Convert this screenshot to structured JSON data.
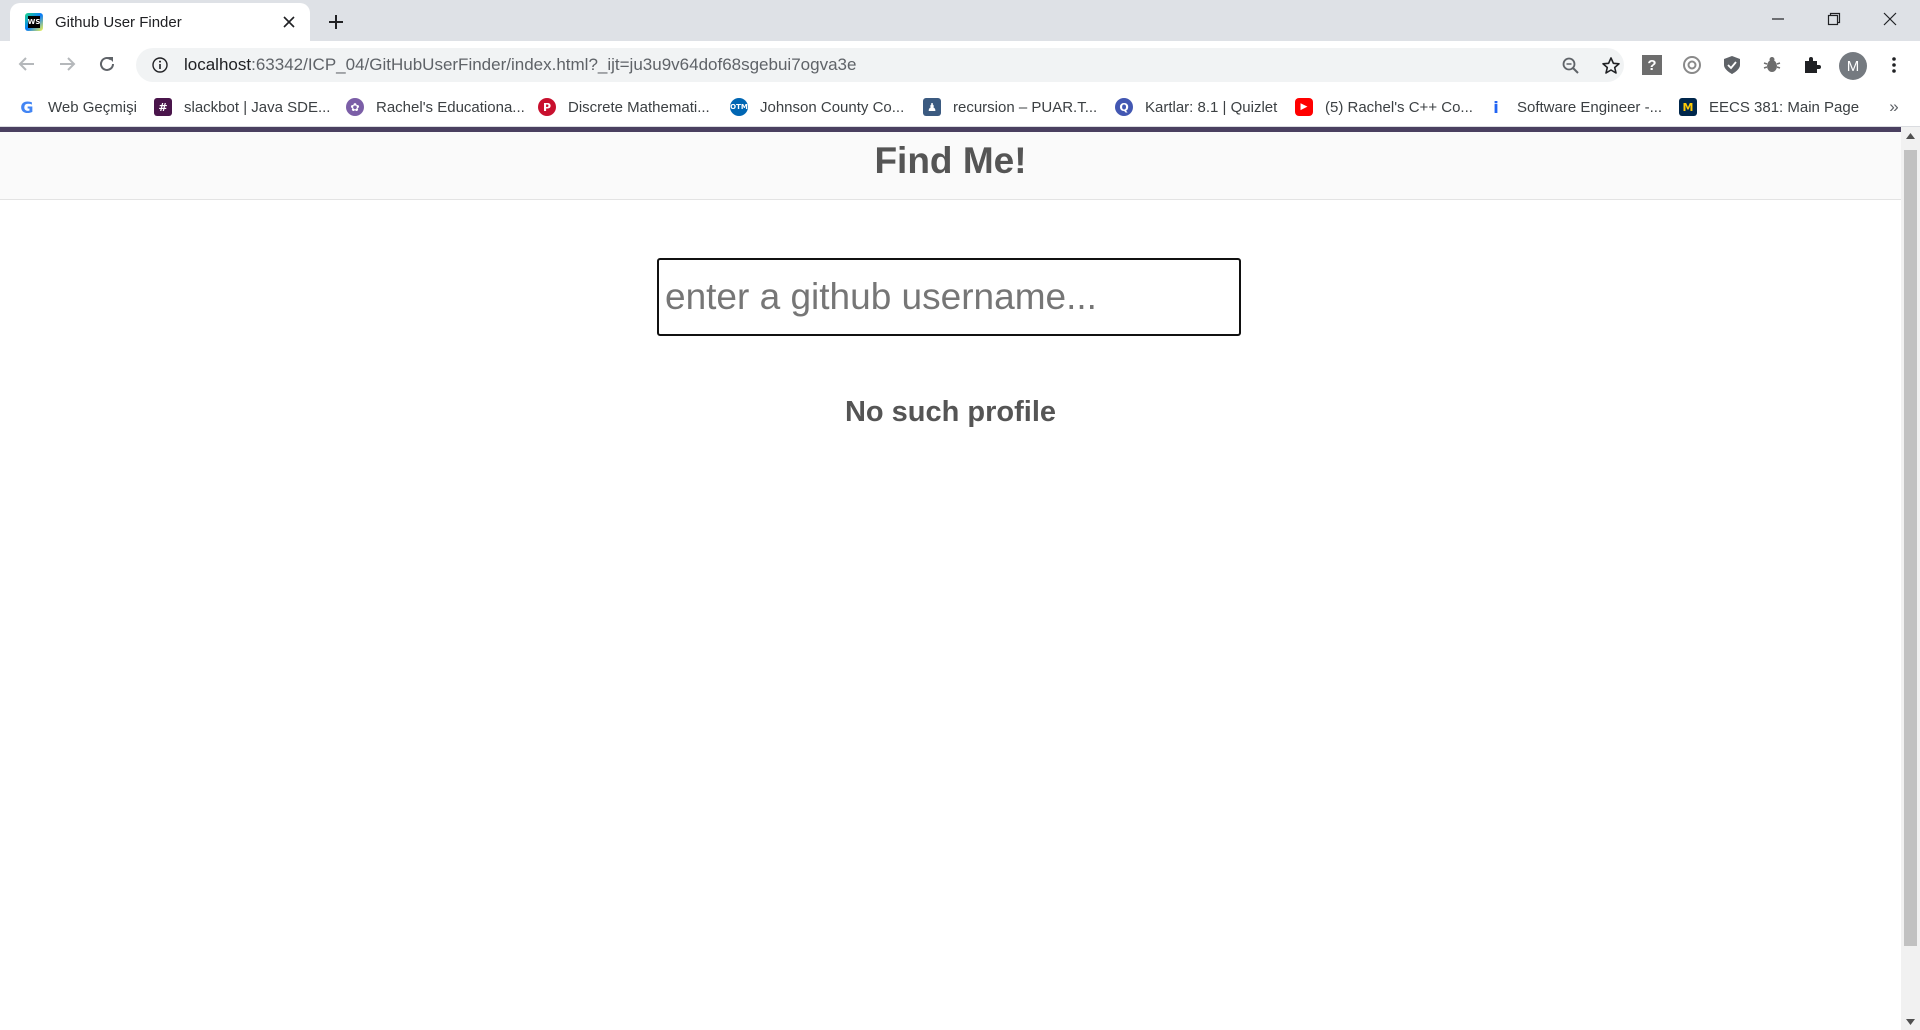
{
  "browser": {
    "tab": {
      "title": "Github User Finder",
      "favicon": "WS"
    },
    "new_tab_label": "+",
    "url": {
      "host": "localhost",
      "rest": ":63342/ICP_04/GitHubUserFinder/index.html?_ijt=ju3u9v64dof68sgebui7ogva3e"
    },
    "profile_initial": "M",
    "bookmarks": [
      {
        "label": "Web Geçmişi",
        "icon": "google-icon"
      },
      {
        "label": "slackbot | Java SDE...",
        "icon": "slack-icon"
      },
      {
        "label": "Rachel's Educationa...",
        "icon": "puzzle-icon"
      },
      {
        "label": "Discrete Mathemati...",
        "icon": "pgcc-icon"
      },
      {
        "label": "Johnson County Co...",
        "icon": "jccc-icon"
      },
      {
        "label": "recursion – PUAR.T...",
        "icon": "puar-icon"
      },
      {
        "label": "Kartlar: 8.1 | Quizlet",
        "icon": "quizlet-icon"
      },
      {
        "label": "(5) Rachel's C++ Co...",
        "icon": "youtube-icon"
      },
      {
        "label": "Software Engineer -...",
        "icon": "indeed-icon"
      },
      {
        "label": "EECS 381: Main Page",
        "icon": "umich-icon"
      }
    ],
    "bookmarks_overflow": "»"
  },
  "page": {
    "title": "Find Me!",
    "search": {
      "placeholder": "enter a github username...",
      "value": ""
    },
    "message": "No such profile"
  }
}
